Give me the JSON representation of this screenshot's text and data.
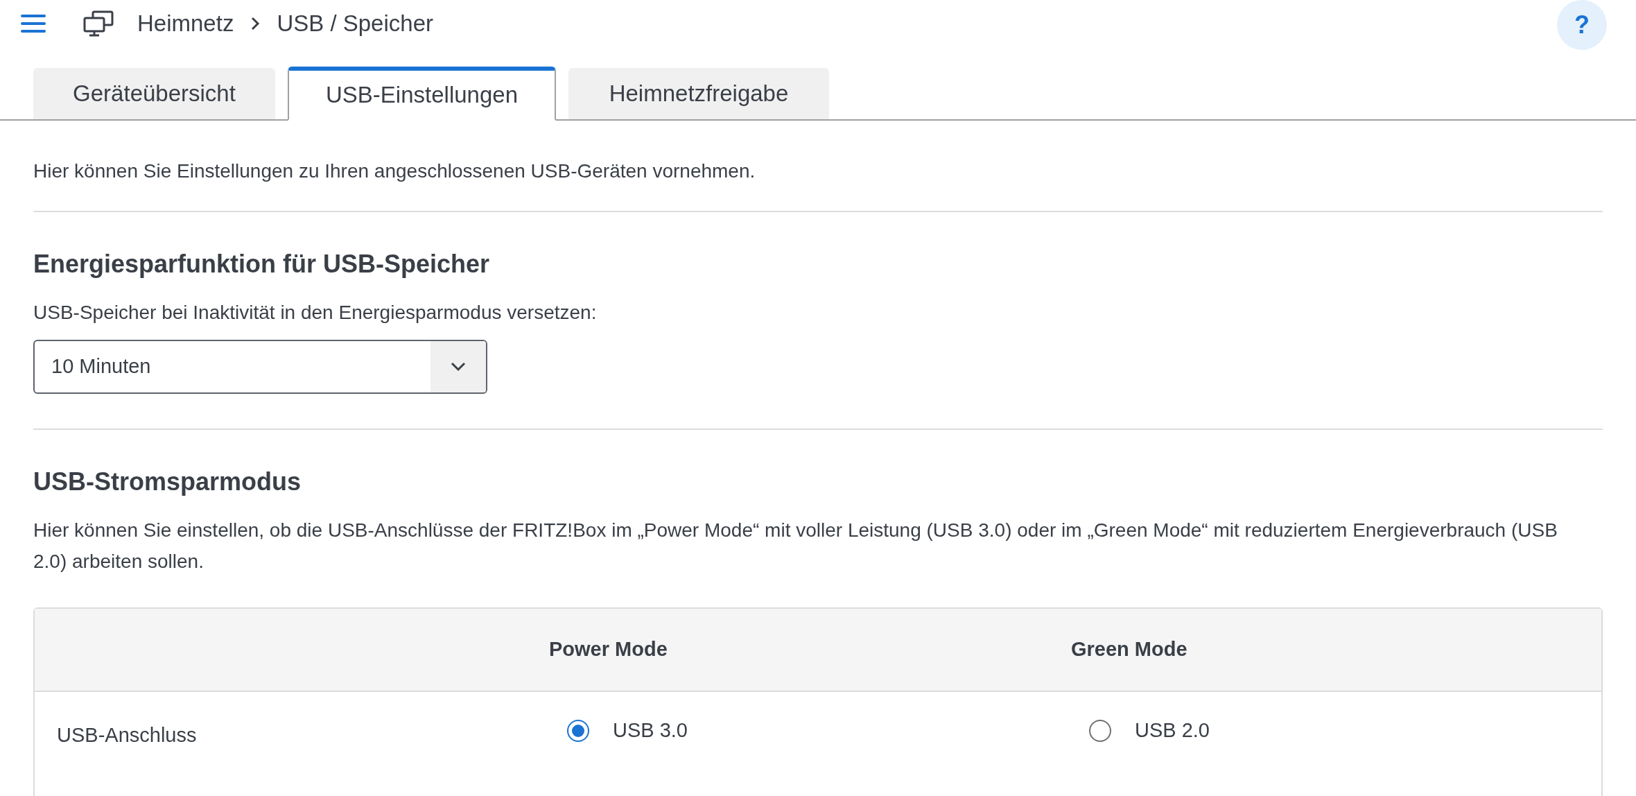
{
  "breadcrumb": [
    "Heimnetz",
    "USB / Speicher"
  ],
  "help": "?",
  "tabs": [
    {
      "label": "Geräteübersicht",
      "selected": false
    },
    {
      "label": "USB-Einstellungen",
      "selected": true
    },
    {
      "label": "Heimnetzfreigabe",
      "selected": false
    }
  ],
  "intro": "Hier können Sie Einstellungen zu Ihren angeschlossenen USB-Geräten vornehmen.",
  "energy": {
    "heading": "Energiesparfunktion für USB-Speicher",
    "label": "USB-Speicher bei Inaktivität in den Energiesparmodus versetzen:",
    "value": "10 Minuten"
  },
  "power": {
    "heading": "USB-Stromsparmodus",
    "description": "Hier können Sie einstellen, ob die USB-Anschlüsse der FRITZ!Box im „Power Mode“ mit voller Leistung (USB 3.0) oder im „Green Mode“ mit reduziertem Energieverbrauch (USB 2.0) arbeiten sollen.",
    "table": {
      "columns": [
        "Power Mode",
        "Green Mode"
      ],
      "rows": [
        {
          "label": "USB-Anschluss",
          "options": [
            {
              "label": "USB 3.0",
              "selected": true
            },
            {
              "label": "USB 2.0",
              "selected": false
            }
          ]
        }
      ]
    }
  }
}
